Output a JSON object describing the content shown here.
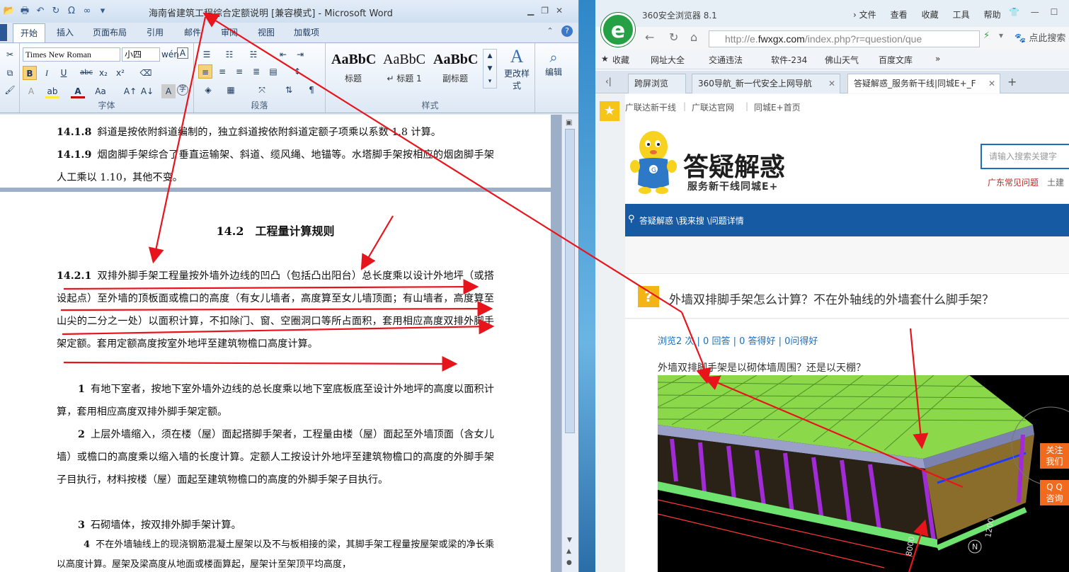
{
  "word": {
    "title": "海南省建筑工程综合定额说明 [兼容模式] - Microsoft Word",
    "qat_icons": [
      "open-icon",
      "print-icon",
      "undo-icon",
      "redo-icon",
      "symbol-icon",
      "equation-icon"
    ],
    "qat_symbol": "Ω",
    "tabs": [
      "开始",
      "插入",
      "页面布局",
      "引用",
      "邮件",
      "审阅",
      "视图",
      "加载项"
    ],
    "font_name": "Times New Roman",
    "font_size": "小四",
    "groups": {
      "font": "字体",
      "paragraph": "段落",
      "styles": "样式"
    },
    "styles": [
      {
        "sample": "AaBbC",
        "name": "标题"
      },
      {
        "sample": "AaBbC",
        "name": "↵ 标题 1"
      },
      {
        "sample": "AaBbC",
        "name": "副标题"
      }
    ],
    "change_styles": "更改样式",
    "edit": "编辑",
    "paragraphs_page1": [
      {
        "num": "14.1.8",
        "text": "斜道是按依附斜道编制的，独立斜道按依附斜道定额子项乘以系数 1.8 计算。"
      },
      {
        "num": "14.1.9",
        "text": "烟囱脚手架综合了垂直运输架、斜道、缆风绳、地锚等。水塔脚手架按相应的烟囱脚手架人工乘以 1.10，其他不变。"
      }
    ],
    "heading": "14.2　工程量计算规则",
    "para_1421": {
      "num": "14.2.1",
      "text": "双排外脚手架工程量按外墙外边线的凹凸（包括凸出阳台）总长度乘以设计外地坪（或搭设起点）至外墙的顶板面或檐口的高度（有女儿墙者，高度算至女儿墙顶面；有山墙者，高度算至山尖的二分之一处）以面积计算，不扣除门、窗、空圈洞口等所占面积，套用相应高度双排外脚手架定额。套用定额高度按室外地坪至建筑物檐口高度计算。"
    },
    "items": [
      {
        "num": "1",
        "text": "有地下室者，按地下室外墙外边线的总长度乘以地下室底板底至设计外地坪的高度以面积计算，套用相应高度双排外脚手架定额。"
      },
      {
        "num": "2",
        "text": "上层外墙缩入，须在楼（屋）面起搭脚手架者，工程量由楼（屋）面起至外墙顶面（含女儿墙）或檐口的高度乘以缩入墙的长度计算。定额人工按设计外地坪至建筑物檐口的高度的外脚手架子目执行，材料按楼（屋）面起至建筑物檐口的高度的外脚手架子目执行。"
      },
      {
        "num": "3",
        "text": "石砌墙体，按双排外脚手架计算。"
      },
      {
        "num": "4",
        "text": "不在外墙轴线上的现浇钢筋混凝土屋架以及不与板相接的梁，其脚手架工程量按屋架或梁的净长乘以高度计算。屋架及梁高度从地面或楼面算起，屋架计至架顶平均高度，"
      }
    ]
  },
  "browser": {
    "app_name": "360安全浏览器 8.1",
    "menu": [
      "› 文件",
      "查看",
      "收藏",
      "工具",
      "帮助"
    ],
    "address": {
      "prefix": "http://e.",
      "domain": "fwxgx.com",
      "path": "/index.php?r=question/que"
    },
    "search_hint": "点此搜索",
    "favorites": [
      "收藏",
      "网址大全",
      "交通违法",
      "软件-234",
      "佛山天气",
      "百度文库"
    ],
    "tabs": [
      "跨屏浏览",
      "360导航_新一代安全上网导航",
      "答疑解惑_服务新干线|同城E+_F"
    ],
    "toplinks": [
      "广联达新干线",
      "|",
      "广联达官网",
      "|",
      "同城E+首页"
    ],
    "site_title": "答疑解惑",
    "site_subtitle": "服务新干线同城E+",
    "search_placeholder": "请输入搜索关键字",
    "hot_links": [
      "广东常见问题",
      "土建"
    ],
    "breadcrumb": "答疑解惑 \\我来搜 \\问题详情",
    "question_title": "外墙双排脚手架怎么计算？不在外轴线的外墙套什么脚手架？",
    "stats": "浏览2 次 | 0 回答 | 0 答得好 | 0问得好",
    "question_text": "外墙双排脚手架是以砌体墙周围？还是以天棚？",
    "float_follow": [
      "关注",
      "我们"
    ],
    "float_qq": [
      "Q Q",
      "咨询"
    ],
    "model_dims": [
      "8000",
      "1200"
    ],
    "compass": "N"
  },
  "colors": {
    "annotation": "#e8141c",
    "word_accent": "#2b5797",
    "site_blue": "#155aa3",
    "browser_green": "#25a045"
  }
}
